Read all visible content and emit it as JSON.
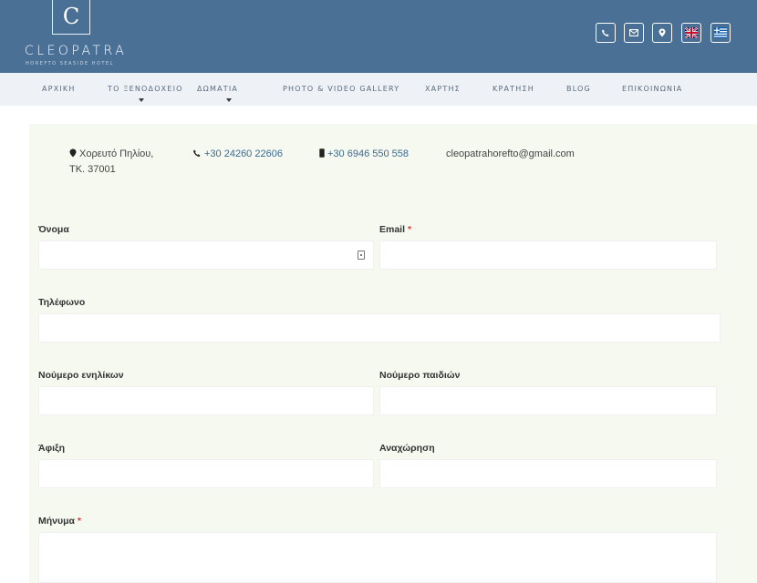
{
  "brand": {
    "logo_letter": "C",
    "name": "CLEOPATRA",
    "tagline": "HOREFTO SEASIDE HOTEL"
  },
  "header_icons": [
    "phone-icon",
    "mail-icon",
    "location-icon",
    "uk-flag-icon",
    "greek-flag-icon"
  ],
  "nav": {
    "items": [
      {
        "label": "ΑΡΧΙΚΗ",
        "has_submenu": false
      },
      {
        "label": "ΤΟ ΞΕΝΟΔΟΧΕΙΟ",
        "has_submenu": true
      },
      {
        "label": "ΔΩΜΑΤΙΑ",
        "has_submenu": true
      },
      {
        "label": "PHOTO & VIDEO GALLERY",
        "has_submenu": false
      },
      {
        "label": "ΧΑΡΤΗΣ",
        "has_submenu": false
      },
      {
        "label": "ΚΡΑΤΗΣΗ",
        "has_submenu": false
      },
      {
        "label": "BLOG",
        "has_submenu": false
      },
      {
        "label": "ΕΠΙΚΟΙΝΩΝΙΑ",
        "has_submenu": false
      }
    ]
  },
  "contact": {
    "address_line1": "Χορευτό Πηλίου,",
    "address_line2": "ΤΚ. 37001",
    "phone": "+30 24260 22606",
    "mobile": "+30 6946 550 558",
    "email": "cleopatrahorefto@gmail.com"
  },
  "form": {
    "name_label": "Όνομα",
    "email_label": "Email",
    "phone_label": "Τηλέφωνο",
    "adults_label": "Νούμερο ενηλίκων",
    "children_label": "Νούμερο παιδιών",
    "arrival_label": "Άφιξη",
    "departure_label": "Αναχώρηση",
    "message_label": "Μήνυμα",
    "required_mark": "*"
  },
  "colors": {
    "header_bg": "#4a7096",
    "nav_bg": "#eef2f7",
    "panel_bg": "#f5f9ef",
    "link": "#3d6a96",
    "required": "#e53935"
  }
}
